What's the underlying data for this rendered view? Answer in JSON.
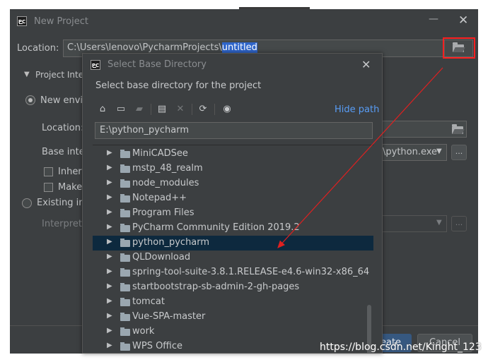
{
  "window": {
    "title": "New Project",
    "minimize_glyph": "—",
    "close_glyph": "✕",
    "logo_text": "PC"
  },
  "location": {
    "label": "Location:",
    "path_prefix": "C:\\Users\\lenovo\\PycharmProjects\\",
    "path_selected": "untitled"
  },
  "project_interpreter": {
    "header": "Project Interp",
    "new_env_label": "New enviro",
    "location_label": "Location:",
    "base_label": "Base inter",
    "base_value": "\\python.exe",
    "inherit_label": "Inherit",
    "make_label": "Make",
    "existing_label": "Existing inte",
    "interpreter_label": "Interprete",
    "browse_glyph": "..."
  },
  "footer": {
    "create_label": "reate",
    "cancel_label": "Cancel"
  },
  "dialog": {
    "title": "Select Base Directory",
    "close_glyph": "✕",
    "description": "Select base directory for the project",
    "hide_path_label": "Hide path",
    "path_value": "E:\\python_pycharm",
    "toolbar_icons": [
      "home-icon",
      "desktop-icon",
      "project-folder-icon",
      "new-folder-icon",
      "delete-icon",
      "refresh-icon",
      "show-hidden-icon"
    ],
    "tree_items": [
      {
        "label": "MiniCADSee",
        "selected": false
      },
      {
        "label": "mstp_48_realm",
        "selected": false
      },
      {
        "label": "node_modules",
        "selected": false
      },
      {
        "label": "Notepad++",
        "selected": false
      },
      {
        "label": "Program Files",
        "selected": false
      },
      {
        "label": "PyCharm Community Edition 2019.2",
        "selected": false
      },
      {
        "label": "python_pycharm",
        "selected": true
      },
      {
        "label": "QLDownload",
        "selected": false
      },
      {
        "label": "spring-tool-suite-3.8.1.RELEASE-e4.6-win32-x86_64",
        "selected": false
      },
      {
        "label": "startbootstrap-sb-admin-2-gh-pages",
        "selected": false
      },
      {
        "label": "tomcat",
        "selected": false
      },
      {
        "label": "Vue-SPA-master",
        "selected": false
      },
      {
        "label": "work",
        "selected": false
      },
      {
        "label": "WPS Office",
        "selected": false
      }
    ]
  },
  "watermark": "https://blog.csdn.net/Kinght_123",
  "colors": {
    "window_bg": "#3c3f41",
    "selection_bg": "#2f65ca",
    "tree_selected": "#0d293e",
    "link": "#589df6",
    "annotation_red": "#ff2020"
  }
}
